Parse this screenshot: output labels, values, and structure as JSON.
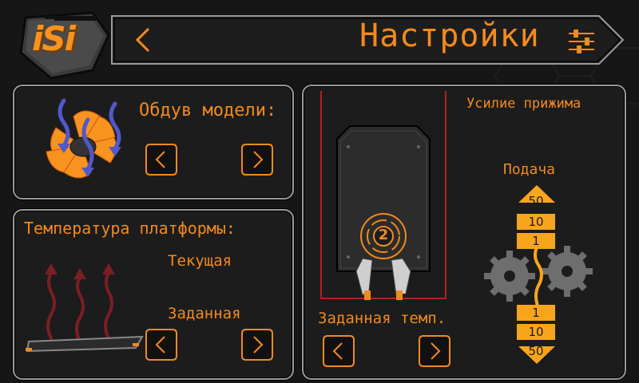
{
  "header": {
    "title": "Настройки",
    "logo_text": "iSi",
    "back_icon": "chevron-left-icon",
    "settings_icon": "sliders-icon"
  },
  "fan_panel": {
    "label": "Обдув модели:",
    "prev_icon": "chevron-left-icon",
    "next_icon": "chevron-right-icon"
  },
  "platform_panel": {
    "title": "Температура платформы:",
    "current_label": "Текущая",
    "target_label": "Заданная",
    "prev_icon": "chevron-left-icon",
    "next_icon": "chevron-right-icon"
  },
  "extruder_panel": {
    "pressure_label": "Усилие прижима",
    "feed_label": "Подача",
    "target_temp_label": "Заданная темп.",
    "nozzle_number": "2",
    "feed_up": [
      "50",
      "10",
      "1"
    ],
    "feed_down": [
      "1",
      "10",
      "50"
    ],
    "prev_icon": "chevron-left-icon",
    "next_icon": "chevron-right-icon"
  },
  "colors": {
    "accent": "#f28a1e",
    "frame": "#9a9a9a",
    "background": "#161616"
  }
}
